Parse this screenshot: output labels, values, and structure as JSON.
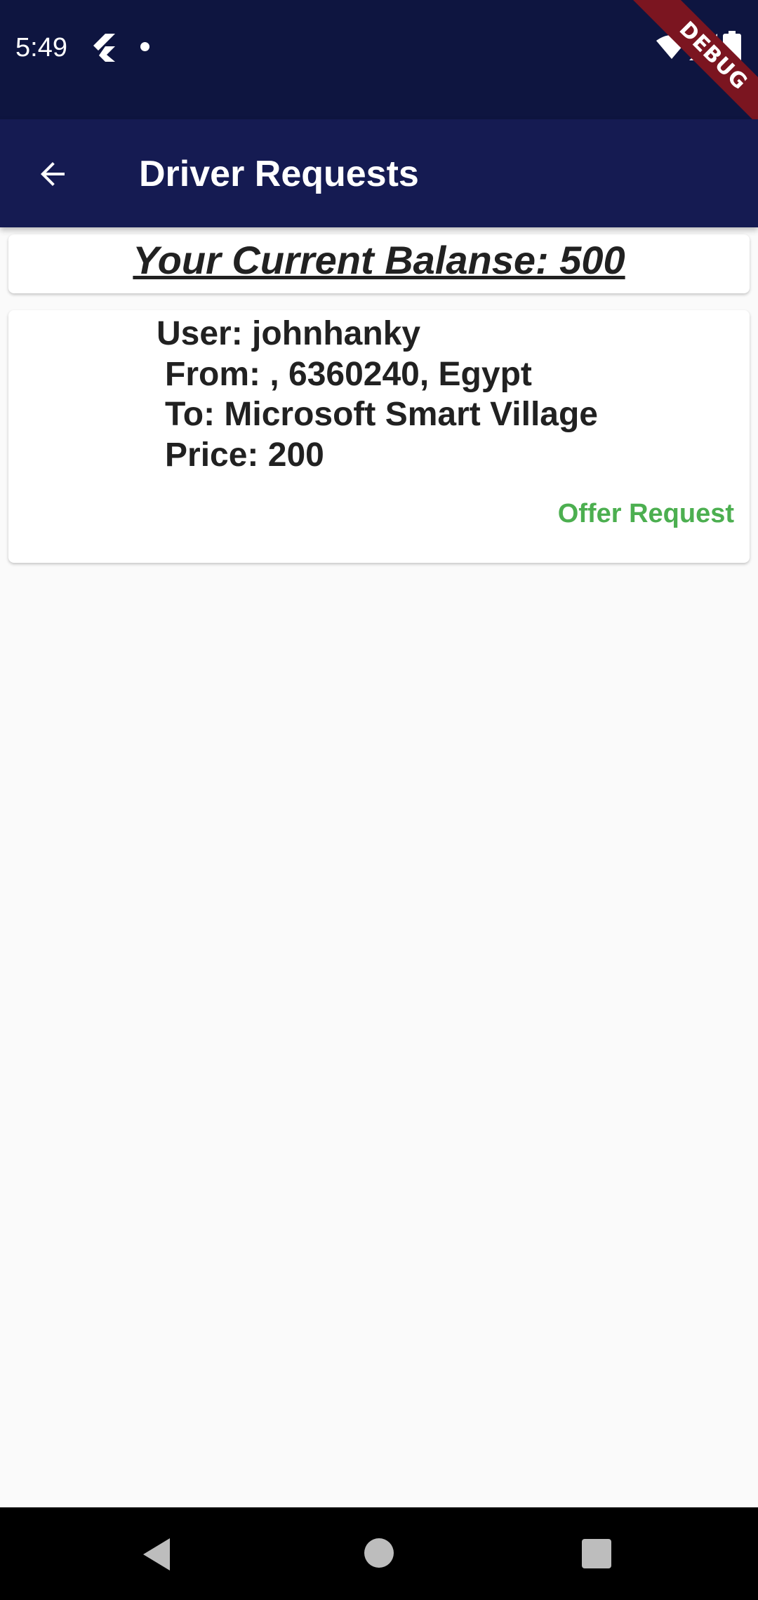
{
  "status_bar": {
    "time": "5:49",
    "icons": [
      "flutter-icon",
      "notification-dot",
      "wifi-icon",
      "signal-icon",
      "battery-icon"
    ]
  },
  "debug_banner": {
    "label": "DEBUG"
  },
  "app_bar": {
    "title": "Driver Requests",
    "back_icon": "arrow-back-icon",
    "background_color": "#151b52"
  },
  "balance": {
    "text": "Your Current Balanse: 500"
  },
  "requests": [
    {
      "user": "User: johnhanky",
      "from": "From: , 6360240, Egypt",
      "to": "To: Microsoft Smart Village",
      "price": "Price: 200",
      "action_label": "Offer Request",
      "action_color": "#4caf50"
    }
  ],
  "nav_bar": {
    "icons": [
      "nav-back-icon",
      "nav-home-icon",
      "nav-recents-icon"
    ]
  }
}
